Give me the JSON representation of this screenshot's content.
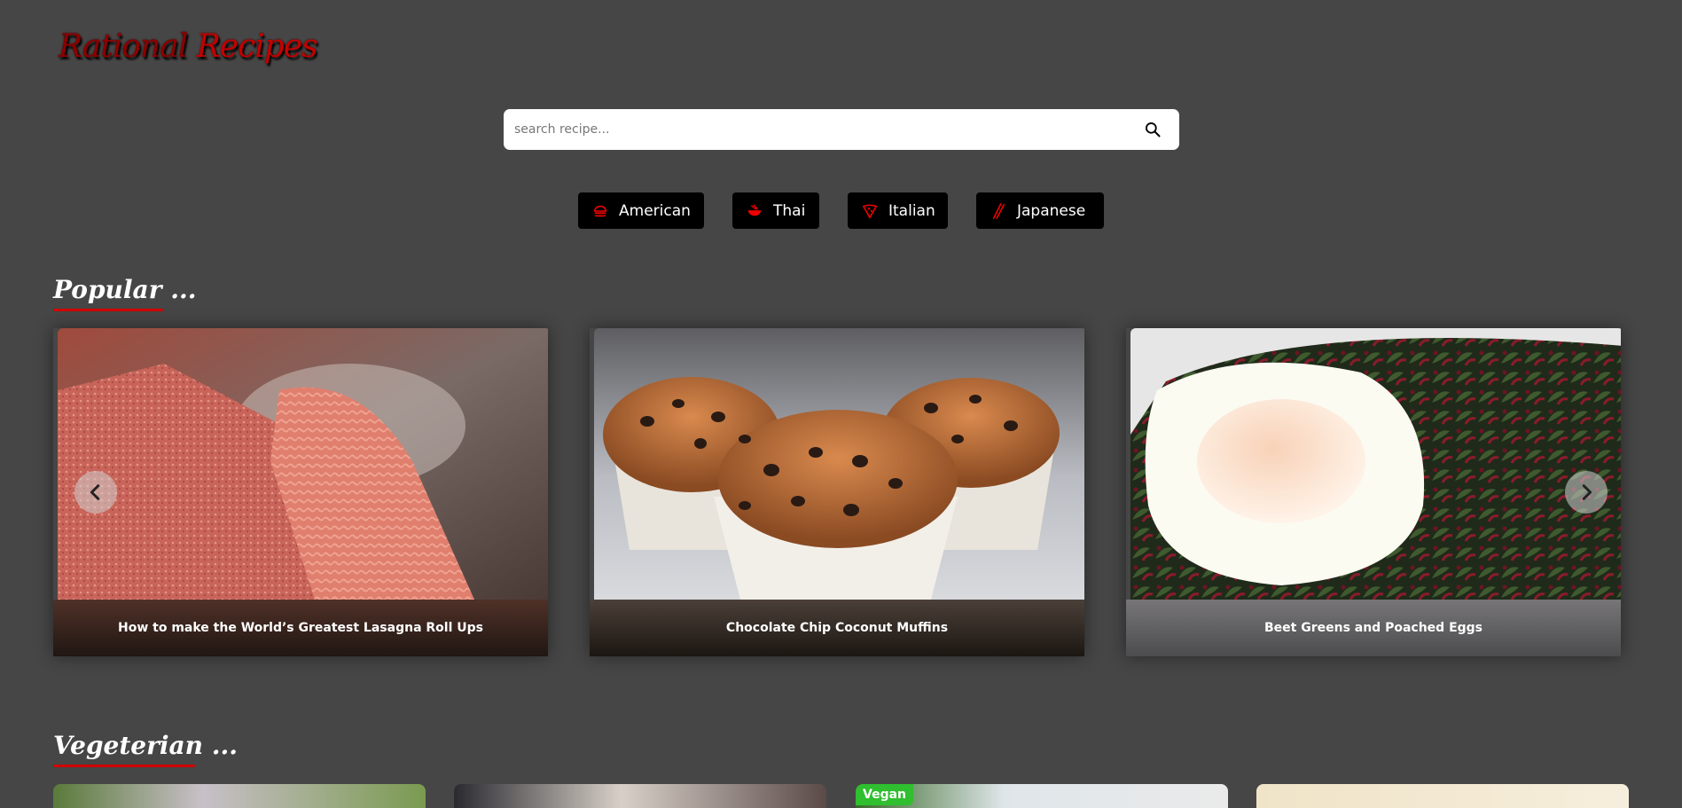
{
  "brand": {
    "logo_text_1": "Rational",
    "logo_text_2": "Recipes"
  },
  "search": {
    "placeholder": "search recipe...",
    "icon": "search-icon"
  },
  "cuisines": [
    {
      "label": "American",
      "icon": "burger-icon"
    },
    {
      "label": "Thai",
      "icon": "noodle-bowl-icon"
    },
    {
      "label": "Italian",
      "icon": "pizza-icon"
    },
    {
      "label": "Japanese",
      "icon": "chopsticks-icon"
    }
  ],
  "sections": {
    "popular": {
      "title": "Popular ...",
      "cards": [
        {
          "title": "How to make the World’s Greatest Lasagna Roll Ups"
        },
        {
          "title": "Chocolate Chip Coconut Muffins"
        },
        {
          "title": "Beet Greens and Poached Eggs"
        }
      ]
    },
    "vegetarian": {
      "title": "Vegeterian ...",
      "badge": "Vegan"
    }
  },
  "colors": {
    "background": "#464646",
    "accent": "#d10000",
    "vegan": "#2fbf2f"
  }
}
